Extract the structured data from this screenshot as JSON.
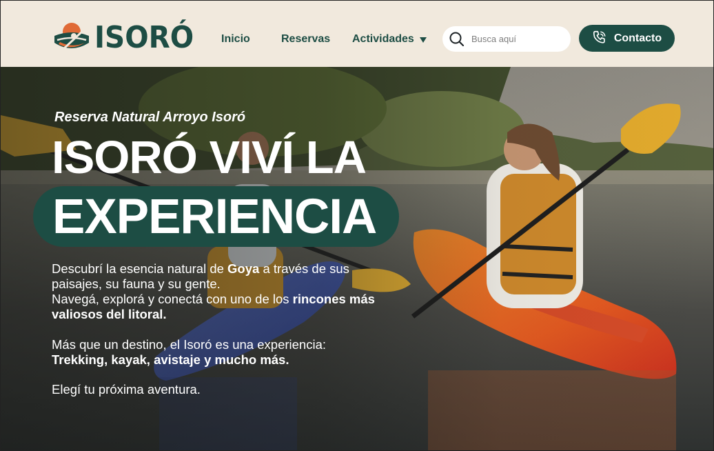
{
  "brand": {
    "name": "ISORÓ",
    "logo_icon": "kayak-sun-logo-icon"
  },
  "colors": {
    "brand_green": "#1d4d44",
    "header_bg": "#f1e9dd",
    "accent_orange": "#e06a36"
  },
  "nav": {
    "inicio": "Inicio",
    "reservas": "Reservas",
    "actividades": "Actividades"
  },
  "search": {
    "placeholder": "Busca aquí",
    "icon": "search-icon"
  },
  "contact": {
    "label": "Contacto",
    "icon": "phone-icon"
  },
  "hero": {
    "eyebrow": "Reserva Natural Arroyo Isoró",
    "title_line1": "ISORÓ VIVÍ LA",
    "title_line2": "EXPERIENCIA",
    "p1": {
      "a": "Descubrí la esencia natural de ",
      "b": "Goya",
      "c": " a través de sus paisajes, su fauna y su gente.",
      "d": "Navegá, explorá y conectá con uno de los ",
      "e": "rincones más valiosos del litoral."
    },
    "p2": {
      "a": "Más que un destino, el Isoró es una experiencia:",
      "b": "Trekking, kayak, avistaje y mucho más."
    },
    "p3": "Elegí tu próxima aventura."
  }
}
